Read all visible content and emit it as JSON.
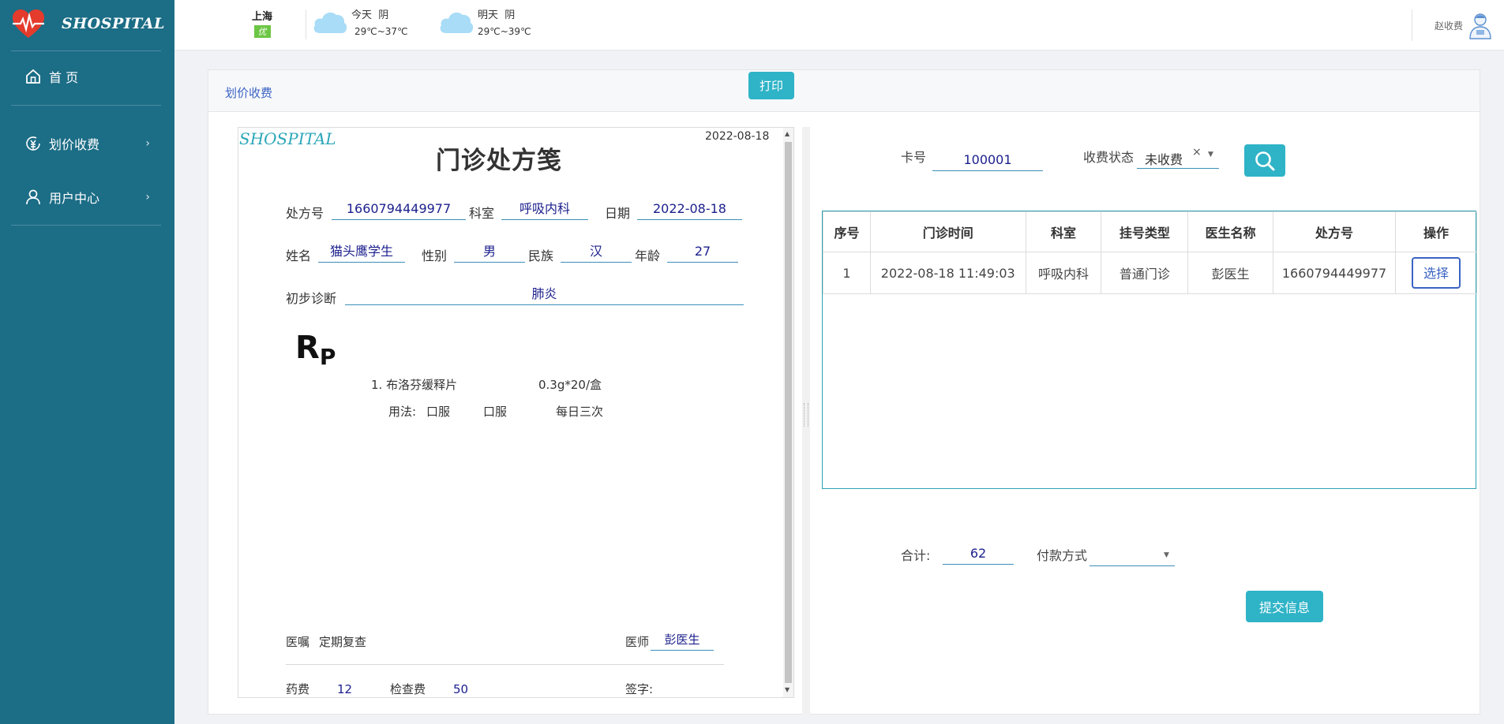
{
  "sidebar": {
    "brand": "SHOSPITAL",
    "items": [
      {
        "label": "首 页",
        "icon": "home-icon"
      },
      {
        "label": "划价收费",
        "icon": "yuan-coin-icon"
      },
      {
        "label": "用户中心",
        "icon": "user-icon"
      }
    ]
  },
  "header": {
    "city": "上海",
    "air_quality": "优",
    "today": {
      "label": "今天",
      "weather": "阴",
      "temp": "29℃~37℃"
    },
    "tomorrow": {
      "label": "明天",
      "weather": "阴",
      "temp": "29℃~39℃"
    },
    "username": "赵收费"
  },
  "panel": {
    "title": "划价收费",
    "print_label": "打印"
  },
  "prescription": {
    "logo": "SHOSPITAL",
    "top_date": "2022-08-18",
    "title": "门诊处方笺",
    "labels": {
      "rx_no": "处方号",
      "dept": "科室",
      "date": "日期",
      "name": "姓名",
      "gender": "性别",
      "ethnicity": "民族",
      "age": "年龄",
      "diagnosis": "初步诊断",
      "advice": "医嘱",
      "doctor": "医师",
      "drug_fee": "药费",
      "exam_fee": "检查费",
      "signature": "签字:"
    },
    "values": {
      "rx_no": "1660794449977",
      "dept": "呼吸内科",
      "date": "2022-08-18",
      "name": "猫头鹰学生",
      "gender": "男",
      "ethnicity": "汉",
      "age": "27",
      "diagnosis": "肺炎",
      "advice": "定期复查",
      "doctor": "彭医生",
      "drug_fee": "12",
      "exam_fee": "50"
    },
    "rp": "R",
    "rp_sub": "P",
    "medicines": [
      {
        "name": "1. 布洛芬缓释片",
        "spec": "0.3g*20/盒",
        "usage_label": "用法:",
        "route1": "口服",
        "route2": "口服",
        "freq": "每日三次"
      }
    ]
  },
  "search": {
    "card_label": "卡号",
    "card_value": "100001",
    "status_label": "收费状态",
    "status_value": "未收费",
    "clear_glyph": "×"
  },
  "table": {
    "headers": [
      "序号",
      "门诊时间",
      "科室",
      "挂号类型",
      "医生名称",
      "处方号",
      "操作"
    ],
    "rows": [
      [
        "1",
        "2022-08-18 11:49:03",
        "呼吸内科",
        "普通门诊",
        "彭医生",
        "1660794449977",
        "选择"
      ]
    ]
  },
  "footer": {
    "total_label": "合计:",
    "total_value": "62",
    "pay_label": "付款方式",
    "pay_value": "",
    "submit_label": "提交信息"
  },
  "colors": {
    "sidebar": "#1c6d86",
    "accent": "#2fb3c7",
    "link": "#3b63c4",
    "value_text": "#1b1f8c"
  }
}
